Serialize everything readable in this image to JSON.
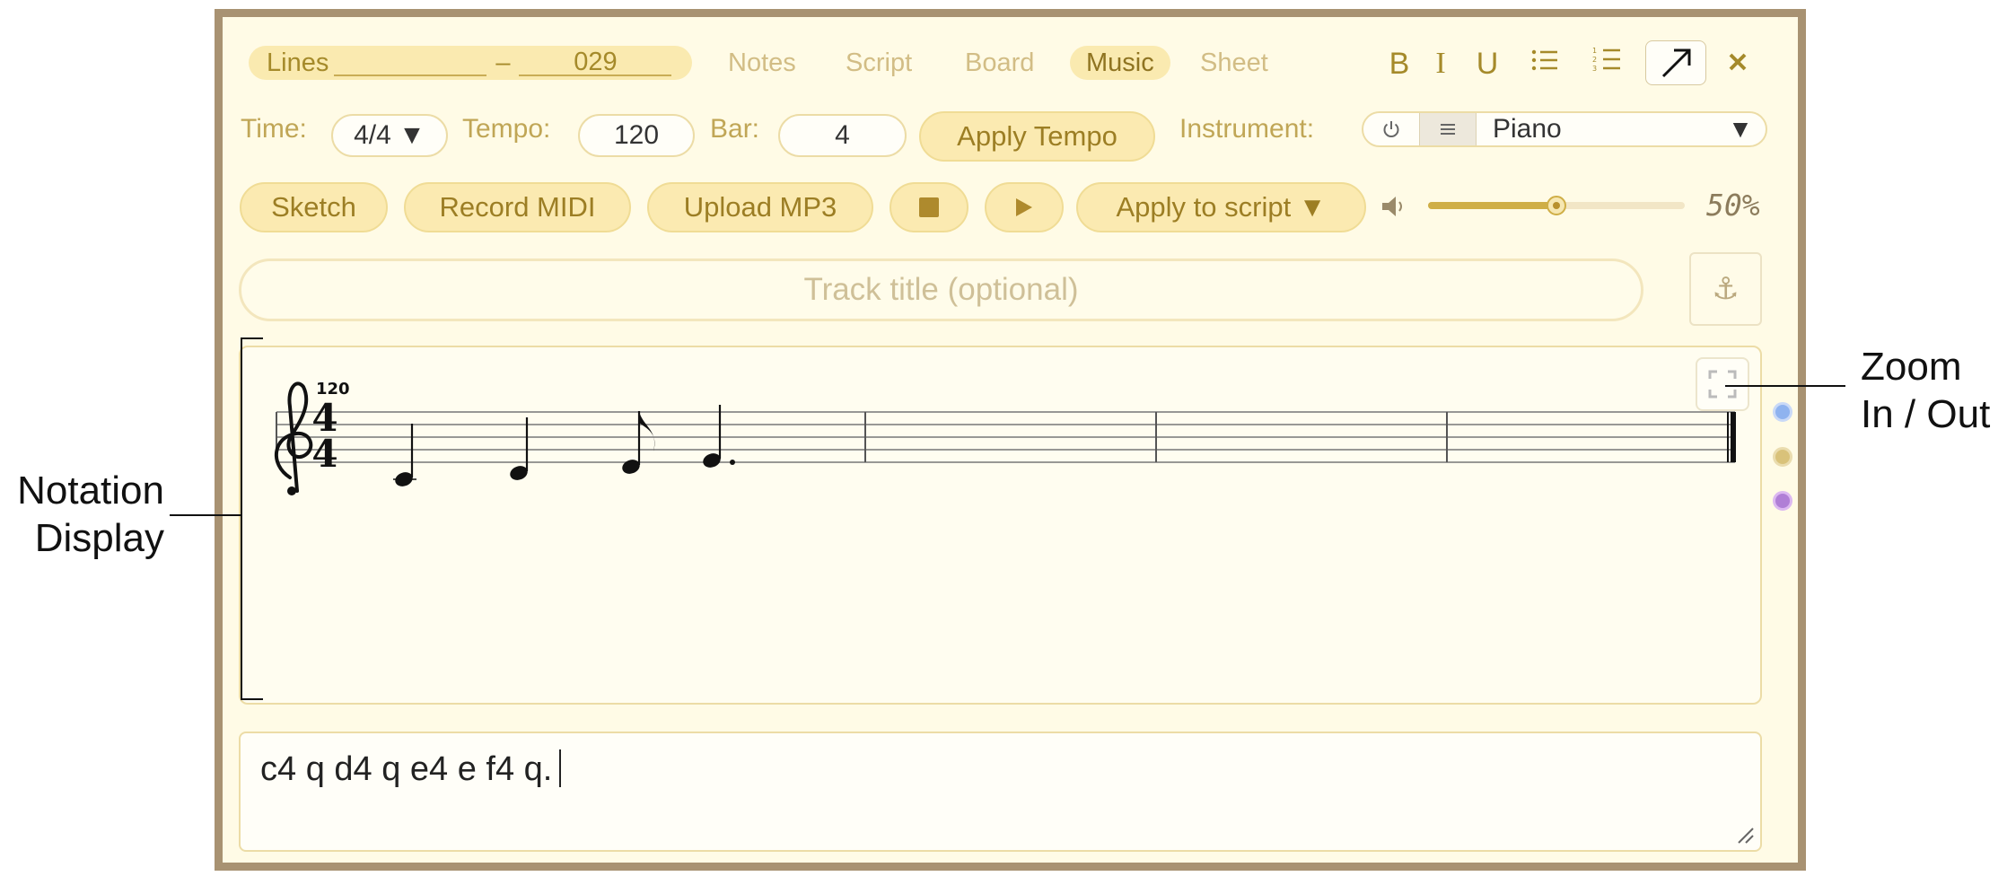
{
  "header": {
    "lines_label": "Lines",
    "lines_dash": "–",
    "lines_value": "029",
    "tabs": [
      {
        "label": "Notes"
      },
      {
        "label": "Script"
      },
      {
        "label": "Board"
      },
      {
        "label": "Music",
        "active": true
      },
      {
        "label": "Sheet"
      }
    ],
    "format_bold": "B",
    "format_italic": "I",
    "format_underline": "U"
  },
  "controls": {
    "time_label": "Time:",
    "time_value": "4/4 ▼",
    "tempo_label": "Tempo:",
    "tempo_value": "120",
    "bar_label": "Bar:",
    "bar_value": "4",
    "apply_tempo": "Apply Tempo",
    "instrument_label": "Instrument:",
    "instrument_value": "Piano",
    "instrument_arrow": "▼"
  },
  "actions": {
    "sketch": "Sketch",
    "record_midi": "Record MIDI",
    "upload_mp3": "Upload MP3",
    "apply_to_script": "Apply to script ▼",
    "volume": 0.5,
    "volume_label": "50%"
  },
  "track_title": {
    "placeholder": "Track title (optional)"
  },
  "notation": {
    "tempo_mark": "120",
    "time_sig_top": "4",
    "time_sig_bottom": "4",
    "notes": [
      "c4 q",
      "d4 q",
      "e4 e",
      "f4 q."
    ],
    "bars": 4
  },
  "script": {
    "text": "c4 q d4 q e4 e f4 q."
  },
  "callouts": {
    "notation_line1": "Notation",
    "notation_line2": "Display",
    "zoom_line1": "Zoom",
    "zoom_line2": "In / Out"
  },
  "colors": {
    "accent": "#cfae46",
    "frame": "#a89272",
    "panel": "#fffbe6",
    "dot_blue": "#8fb3ef",
    "dot_gold": "#d9c27a",
    "dot_purple": "#c68fe4"
  }
}
